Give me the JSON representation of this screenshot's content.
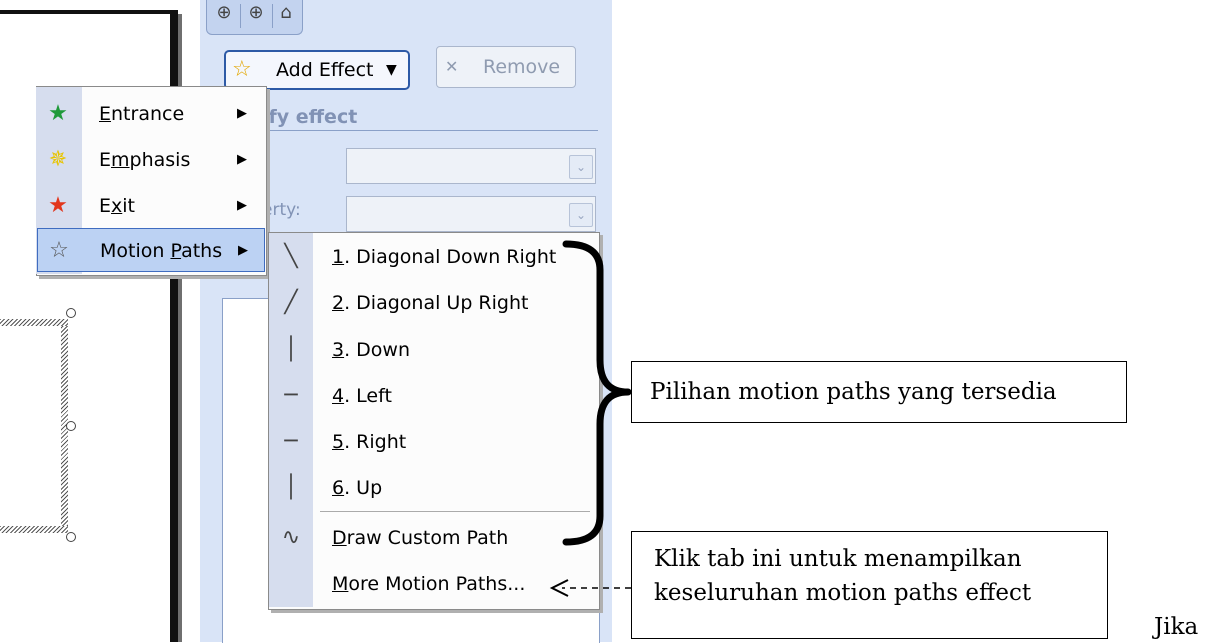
{
  "task_pane": {
    "add_effect_label": "Add Effect",
    "remove_label": "Remove",
    "modify_label": "ify effect",
    "speed_label": ":",
    "property_label": "erty:"
  },
  "context_menu": {
    "items": [
      {
        "icon": "entrance-star-icon",
        "pre": "",
        "key": "E",
        "post": "ntrance"
      },
      {
        "icon": "emphasis-star-icon",
        "pre": "E",
        "key": "m",
        "post": "phasis"
      },
      {
        "icon": "exit-star-icon",
        "pre": "E",
        "key": "x",
        "post": "it"
      },
      {
        "icon": "motion-paths-star-icon",
        "pre": "Motion ",
        "key": "P",
        "post": "aths"
      }
    ]
  },
  "motion_paths_menu": {
    "items": [
      {
        "icon": "diagonal-down-right-icon",
        "key": "1",
        "post": ". Diagonal Down Right"
      },
      {
        "icon": "diagonal-up-right-icon",
        "key": "2",
        "post": ". Diagonal Up Right"
      },
      {
        "icon": "down-path-icon",
        "key": "3",
        "post": ". Down"
      },
      {
        "icon": "left-path-icon",
        "key": "4",
        "post": ". Left"
      },
      {
        "icon": "right-path-icon",
        "key": "5",
        "post": ". Right"
      },
      {
        "icon": "up-path-icon",
        "key": "6",
        "post": ". Up"
      },
      {
        "icon": "draw-custom-path-icon",
        "key": "D",
        "post": "raw Custom Path"
      },
      {
        "icon": "",
        "key": "M",
        "post": "ore Motion Paths..."
      }
    ]
  },
  "annotations": {
    "callout1": "Pilihan motion paths yang tersedia",
    "callout2_line1": "Klik tab ini untuk menampilkan",
    "callout2_line2": "keseluruhan motion paths effect",
    "trailing_text": "Jika"
  }
}
